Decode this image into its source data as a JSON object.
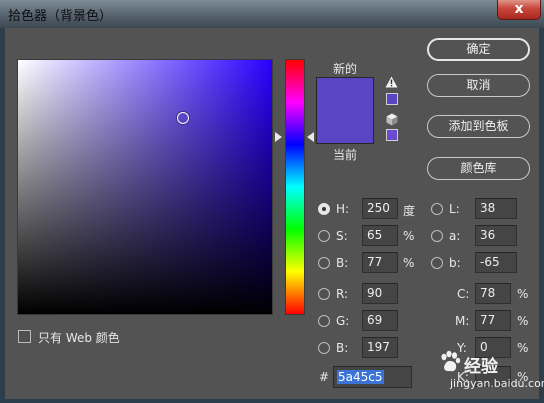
{
  "window": {
    "title": "拾色器（背景色）",
    "close_label": "x"
  },
  "labels": {
    "new": "新的",
    "current": "当前"
  },
  "buttons": {
    "ok": "确定",
    "cancel": "取消",
    "add_to_swatches": "添加到色板",
    "color_libraries": "颜色库"
  },
  "fields": {
    "h": {
      "label": "H:",
      "value": "250",
      "unit": "度",
      "selected": true
    },
    "s": {
      "label": "S:",
      "value": "65",
      "unit": "%"
    },
    "bv": {
      "label": "B:",
      "value": "77",
      "unit": "%"
    },
    "r": {
      "label": "R:",
      "value": "90"
    },
    "g": {
      "label": "G:",
      "value": "69"
    },
    "b": {
      "label": "B:",
      "value": "197"
    },
    "l": {
      "label": "L:",
      "value": "38"
    },
    "a": {
      "label": "a:",
      "value": "36"
    },
    "lab_b": {
      "label": "b:",
      "value": "-65"
    },
    "c": {
      "label": "C:",
      "value": "78",
      "unit": "%"
    },
    "m": {
      "label": "M:",
      "value": "77",
      "unit": "%"
    },
    "y": {
      "label": "Y:",
      "value": "0",
      "unit": "%"
    },
    "k": {
      "label": "K:",
      "value": "",
      "unit": "%"
    },
    "hex": {
      "label": "#",
      "value": "5a45c5"
    }
  },
  "web_colors_only": {
    "label": "只有 Web 颜色",
    "checked": false
  },
  "watermark": {
    "text": "经验",
    "url": "jingyan.baidu.com"
  },
  "colors": {
    "new_color": "#5a45c5",
    "current_color": "#5a45c5",
    "hue_base": "#2a00ff",
    "dialog_bg": "#535353"
  }
}
